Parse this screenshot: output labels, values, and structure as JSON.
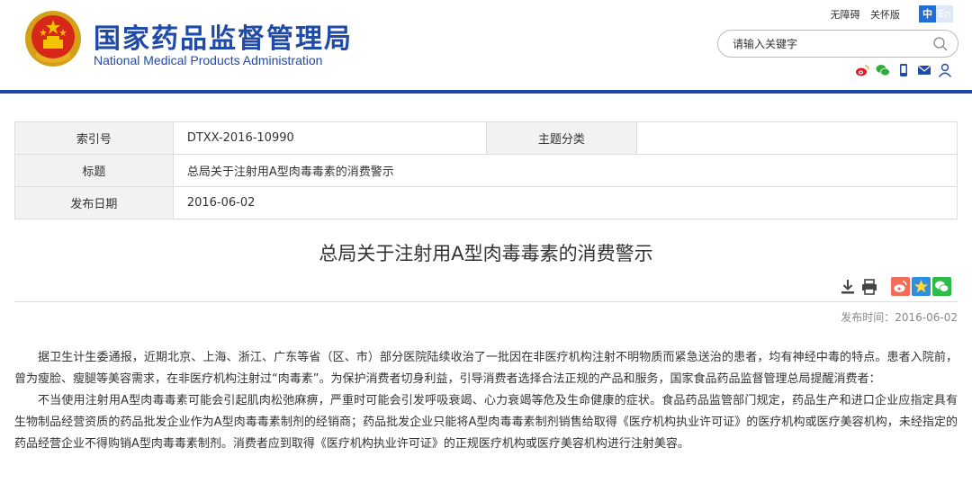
{
  "header": {
    "title_cn": "国家药品监督管理局",
    "title_en": "National Medical Products Administration",
    "links": [
      "无障碍",
      "关怀版"
    ],
    "lang_zh": "中",
    "lang_en": "En",
    "search_placeholder": "请输入关键字",
    "social_icons": [
      "weibo-icon",
      "wechat-icon",
      "mobile-icon",
      "mail-icon",
      "user-icon"
    ],
    "brand_color": "#1f4aa8"
  },
  "info": {
    "index_label": "索引号",
    "index_value": "DTXX-2016-10990",
    "category_label": "主题分类",
    "category_value": "",
    "title_label": "标题",
    "title_value": "总局关于注射用A型肉毒毒素的消费警示",
    "date_label": "发布日期",
    "date_value": "2016-06-02"
  },
  "article": {
    "title": "总局关于注射用A型肉毒毒素的消费警示",
    "publish_time": "发布时间：2016-06-02",
    "paragraphs": [
      "据卫生计生委通报，近期北京、上海、浙江、广东等省（区、市）部分医院陆续收治了一批因在非医疗机构注射不明物质而紧急送治的患者，均有神经中毒的特点。患者入院前，曾为瘦脸、瘦腿等美容需求，在非医疗机构注射过“肉毒素”。为保护消费者切身利益，引导消费者选择合法正规的产品和服务，国家食品药品监督管理总局提醒消费者：",
      "不当使用注射用A型肉毒毒素可能会引起肌肉松弛麻痹，严重时可能会引发呼吸衰竭、心力衰竭等危及生命健康的症状。食品药品监管部门规定，药品生产和进口企业应指定具有生物制品经营资质的药品批发企业作为A型肉毒毒素制剂的经销商；药品批发企业只能将A型肉毒毒素制剂销售给取得《医疗机构执业许可证》的医疗机构或医疗美容机构，未经指定的药品经营企业不得购销A型肉毒毒素制剂。消费者应到取得《医疗机构执业许可证》的正规医疗机构或医疗美容机构进行注射美容。"
    ],
    "tool_icons": [
      "download-icon",
      "print-icon"
    ],
    "share_icons": [
      "weibo-share-icon",
      "qzone-share-icon",
      "wechat-share-icon"
    ]
  }
}
